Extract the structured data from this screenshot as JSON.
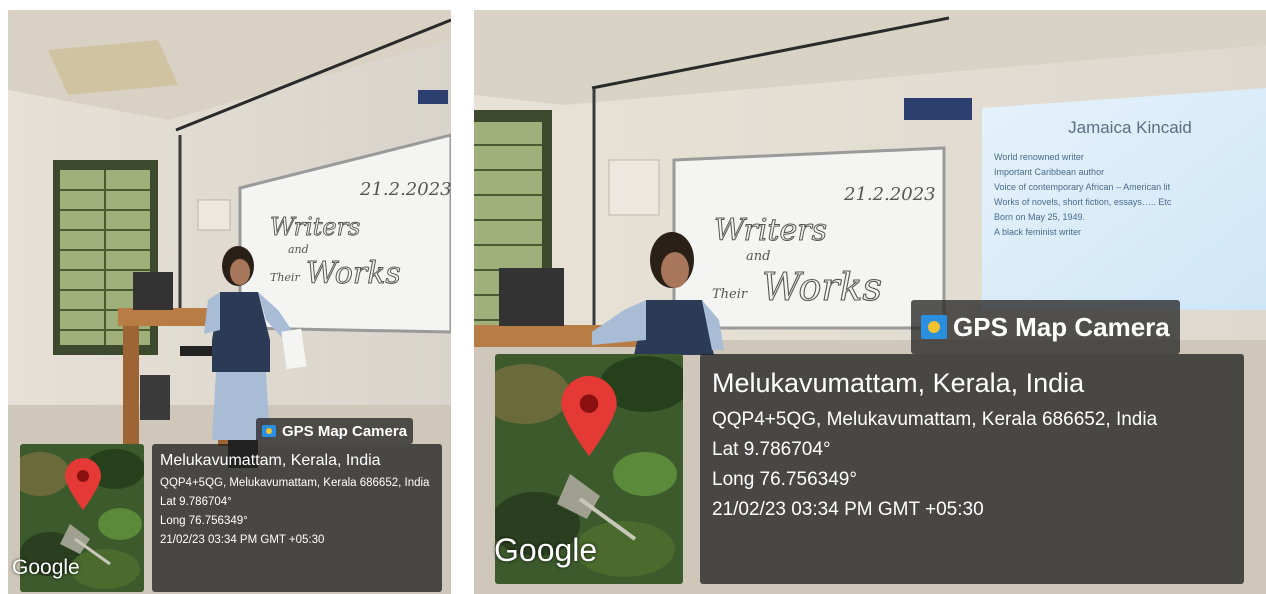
{
  "photos": [
    {
      "board_text": {
        "date": "21.2.2023",
        "line1": "Writers",
        "line2": "and",
        "line3": "Their",
        "line4": "Works"
      },
      "overlay": {
        "app_title": "GPS Map Camera",
        "location_title": "Melukavumattam, Kerala, India",
        "address": "QQP4+5QG, Melukavumattam, Kerala 686652, India",
        "lat": "Lat 9.786704°",
        "long": "Long 76.756349°",
        "datetime": "21/02/23 03:34 PM GMT +05:30",
        "map_logo": "Google"
      }
    },
    {
      "board_text": {
        "date": "21.2.2023",
        "line1": "Writers",
        "line2": "and",
        "line3": "Their",
        "line4": "Works"
      },
      "slide": {
        "title": "Jamaica Kincaid",
        "bullets": [
          "World renowned writer",
          "Important Caribbean author",
          "Voice of contemporary African – American lit",
          "Works of novels, short fiction, essays….. Etc",
          "Born on May 25, 1949.",
          "A black feminist writer"
        ]
      },
      "overlay": {
        "app_title": "GPS Map Camera",
        "location_title": "Melukavumattam, Kerala, India",
        "address": "QQP4+5QG, Melukavumattam, Kerala 686652, India",
        "lat": "Lat 9.786704°",
        "long": "Long 76.756349°",
        "datetime": "21/02/23 03:34 PM GMT +05:30",
        "map_logo": "Google"
      }
    }
  ],
  "colors": {
    "wall": "#e9e3d8",
    "board": "#f4f4f2",
    "uniform": "#2b3a55",
    "pin": "#e53935",
    "map_green": "#3c5a2c"
  }
}
